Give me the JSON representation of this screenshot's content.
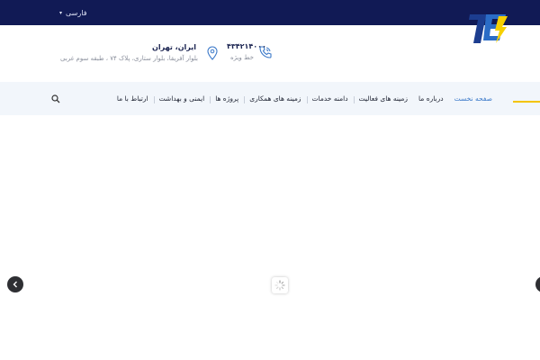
{
  "topbar": {
    "language": "فارسی",
    "background": "#111a55"
  },
  "header": {
    "logo_icon": "company-logo-te",
    "phone": {
      "number": "۴۳۴۲۱۴۰۰۰",
      "label": "خط ویژه",
      "icon": "phone-icon"
    },
    "address": {
      "title": "ایران، تهران",
      "line": "بلوار آفریقا، بلوار ستاری، پلاک ۷۴ ، طبقه سوم غربی",
      "icon": "location-pin-icon"
    }
  },
  "nav": {
    "items": [
      {
        "label": "صفحه نخست",
        "active": true
      },
      {
        "label": "درباره ما",
        "active": false
      },
      {
        "label": "زمینه های فعالیت",
        "active": false
      },
      {
        "label": "دامنه خدمات",
        "active": false
      },
      {
        "label": "زمینه های همکاری",
        "active": false
      },
      {
        "label": "پروژه ها",
        "active": false
      },
      {
        "label": "ایمنی و بهداشت",
        "active": false
      },
      {
        "label": "ارتباط با ما",
        "active": false
      }
    ],
    "search_icon": "search-icon",
    "accent_color": "#3b79c9",
    "highlight_color": "#f4c400"
  },
  "slider": {
    "prev_icon": "chevron-left-icon",
    "next_icon": "chevron-right-icon",
    "loader_icon": "spinner-icon"
  }
}
